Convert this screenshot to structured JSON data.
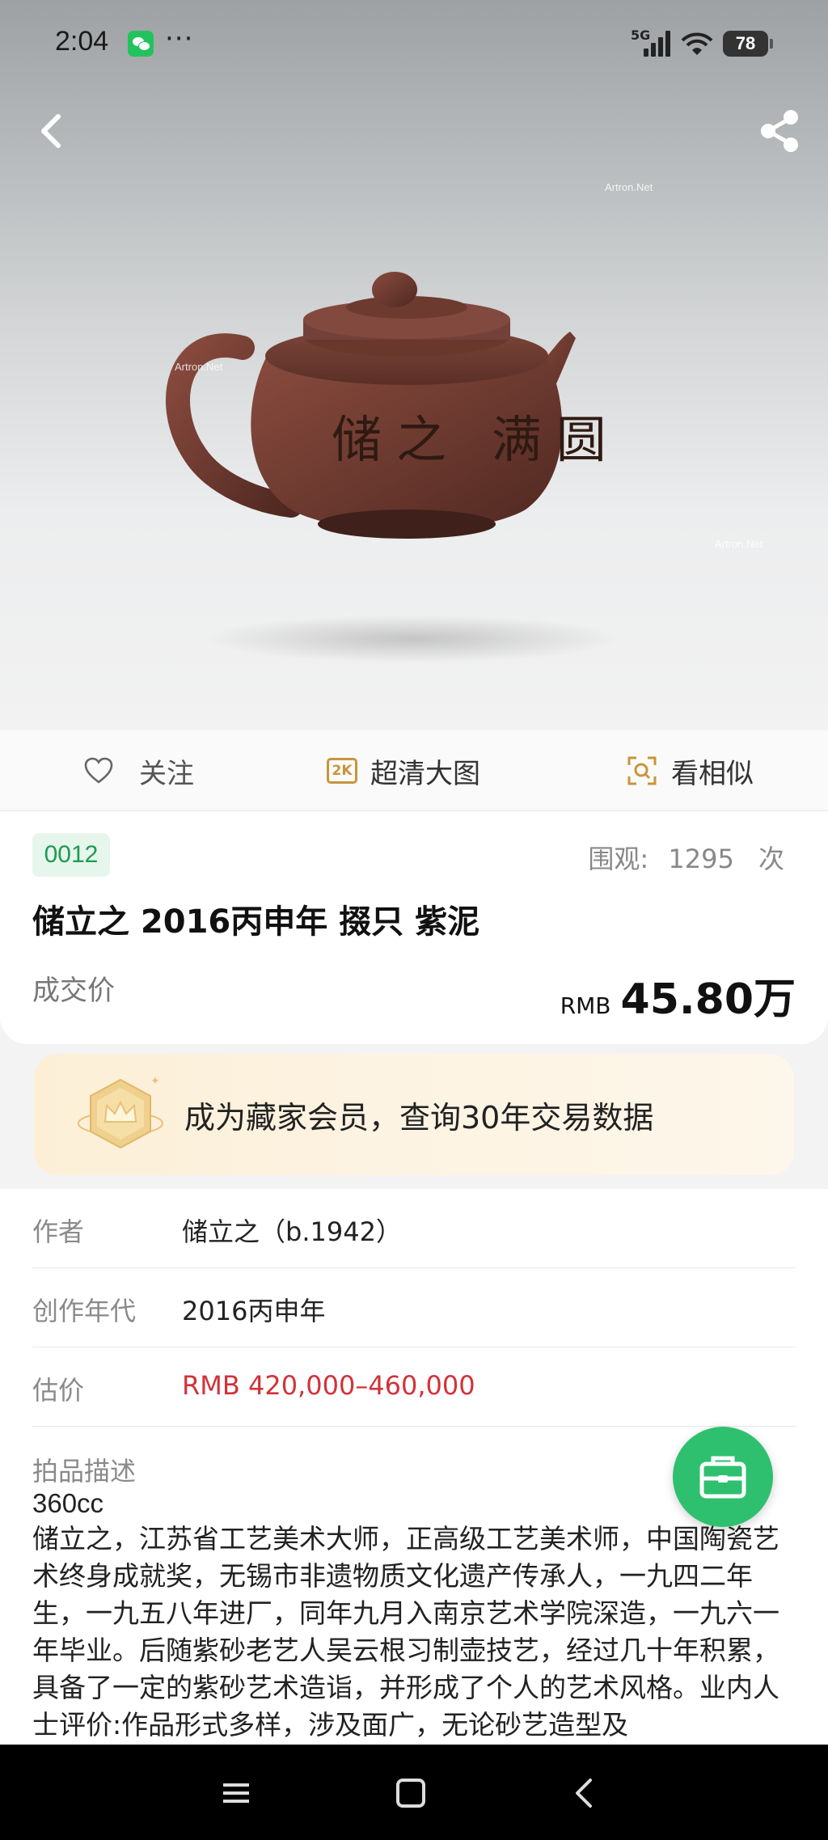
{
  "status_bar": {
    "time": "2:04",
    "menu_dots": "···",
    "network": "5G",
    "battery": "78"
  },
  "hero": {
    "watermarks": [
      "Artron.Net",
      "Artron.Net",
      "Artron.Net"
    ],
    "inscription": "储之 满圆"
  },
  "actions": {
    "follow_label": "关注",
    "hd_badge": "2K",
    "hd_label": "超清大图",
    "similar_label": "看相似"
  },
  "lot": {
    "number": "0012",
    "views_label": "围观:",
    "views_count": "1295",
    "views_unit": "次",
    "title": "储立之 2016丙申年 掇只  紫泥",
    "deal_label": "成交价",
    "price_currency": "RMB",
    "price_amount": "45.80万"
  },
  "member_banner": {
    "text": "成为藏家会员，查询30年交易数据"
  },
  "details": {
    "author_label": "作者",
    "author_value": "储立之（b.1942）",
    "year_label": "创作年代",
    "year_value": "2016丙申年",
    "estimate_label": "估价",
    "estimate_value": "RMB  420,000–460,000",
    "desc_label": "拍品描述",
    "desc_size": "360cc",
    "desc_body": "储立之，江苏省工艺美术大师，正高级工艺美术师，中国陶瓷艺术终身成就奖，无锡市非遗物质文化遗产传承人，一九四二年生，一九五八年进厂，同年九月入南京艺术学院深造，一九六一年毕业。后随紫砂老艺人吴云根习制壶技艺，经过几十年积累，具备了一定的紫砂艺术造诣，并形成了个人的艺术风格。业内人士评价:作品形式多样，涉及面广，无论砂艺造型及"
  },
  "colors": {
    "accent_green": "#2ec06f",
    "lot_green": "#1c9a52",
    "estimate_red": "#d2323a",
    "hd_gold": "#c8953c"
  },
  "icons": [
    "back-icon",
    "share-icon",
    "heart-icon",
    "hd-2k-icon",
    "scan-similar-icon",
    "crown-badge-icon",
    "briefcase-icon",
    "menu-icon",
    "home-icon",
    "nav-back-icon"
  ]
}
